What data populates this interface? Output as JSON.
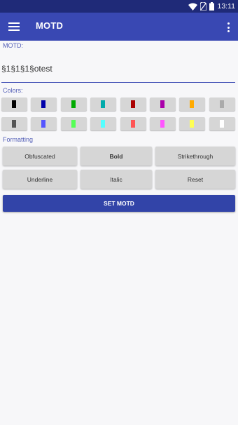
{
  "status_bar": {
    "time": "13:11"
  },
  "app_bar": {
    "title": "MOTD"
  },
  "motd": {
    "label": "MOTD:",
    "value": "§1§1§1§otest"
  },
  "colors": {
    "label": "Colors:",
    "swatches": [
      "#000000",
      "#0000aa",
      "#00aa00",
      "#00aaaa",
      "#aa0000",
      "#aa00aa",
      "#ffaa00",
      "#aaaaaa",
      "#555555",
      "#5555ff",
      "#55ff55",
      "#55ffff",
      "#ff5555",
      "#ff55ff",
      "#ffff55",
      "#ffffff"
    ]
  },
  "formatting": {
    "label": "Formatting",
    "buttons": [
      "Obfuscated",
      "Bold",
      "Strikethrough",
      "Underline",
      "Italic",
      "Reset"
    ]
  },
  "submit": {
    "label": "SET MOTD"
  }
}
